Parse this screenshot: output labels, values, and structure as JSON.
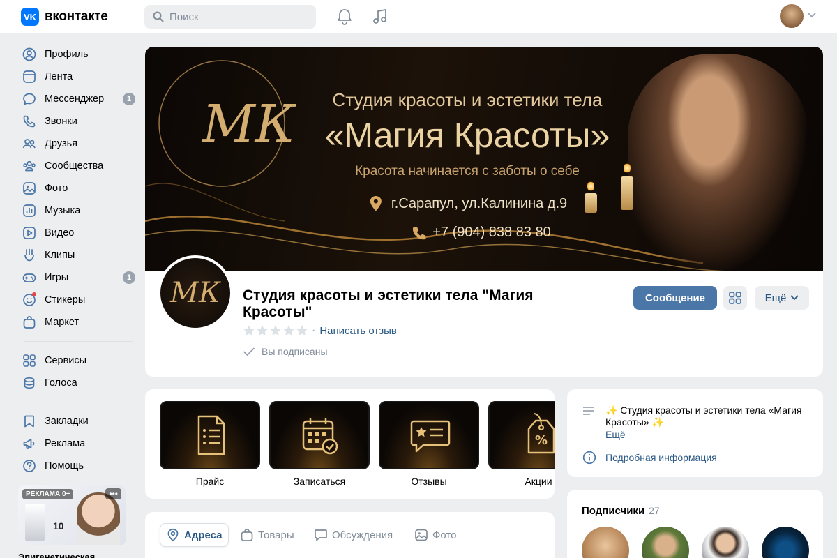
{
  "app": {
    "logo_mark": "VK",
    "logo_text": "вконтакте"
  },
  "search": {
    "placeholder": "Поиск"
  },
  "header": {
    "icons": [
      "bell-icon",
      "music-icon"
    ],
    "avatar": "user-avatar",
    "dropdown": "chevron-down-icon"
  },
  "sidebar": {
    "items": [
      {
        "label": "Профиль",
        "icon": "user-circle-icon"
      },
      {
        "label": "Лента",
        "icon": "feed-icon"
      },
      {
        "label": "Мессенджер",
        "icon": "message-icon",
        "badge": "1"
      },
      {
        "label": "Звонки",
        "icon": "phone-icon"
      },
      {
        "label": "Друзья",
        "icon": "friends-icon"
      },
      {
        "label": "Сообщества",
        "icon": "communities-icon"
      },
      {
        "label": "Фото",
        "icon": "photo-icon"
      },
      {
        "label": "Музыка",
        "icon": "music-icon"
      },
      {
        "label": "Видео",
        "icon": "video-icon"
      },
      {
        "label": "Клипы",
        "icon": "clips-icon"
      },
      {
        "label": "Игры",
        "icon": "gamepad-icon",
        "badge": "1"
      },
      {
        "label": "Стикеры",
        "icon": "sticker-icon"
      },
      {
        "label": "Маркет",
        "icon": "shopping-bag-icon"
      }
    ],
    "items2": [
      {
        "label": "Сервисы",
        "icon": "services-icon"
      },
      {
        "label": "Голоса",
        "icon": "coins-icon"
      }
    ],
    "items3": [
      {
        "label": "Закладки",
        "icon": "bookmark-icon"
      },
      {
        "label": "Реклама",
        "icon": "megaphone-icon"
      },
      {
        "label": "Помощь",
        "icon": "help-icon"
      }
    ]
  },
  "ad": {
    "label": "РЕКЛАМА 0+",
    "more": "•••",
    "number": "10",
    "caption": "Эпигенетическая"
  },
  "cover": {
    "title_line1": "Студия красоты и эстетики тела",
    "title_line2": "«Магия Красоты»",
    "tagline": "Красота начинается с заботы о себе",
    "address": "г.Сарапул, ул.Калинина д.9",
    "phone": "+7 (904) 838 83 80"
  },
  "group": {
    "name": "Студия красоты и эстетики тела \"Магия Красоты\"",
    "rating_stars": 0,
    "review_link": "Написать отзыв",
    "subscribed_text": "Вы подписаны",
    "message_button": "Сообщение",
    "more_button": "Ещё"
  },
  "tiles": [
    {
      "label": "Прайс",
      "icon": "price-list-icon"
    },
    {
      "label": "Записаться",
      "icon": "calendar-icon"
    },
    {
      "label": "Отзывы",
      "icon": "review-icon"
    },
    {
      "label": "Акции",
      "icon": "tag-icon"
    }
  ],
  "tabs": [
    {
      "label": "Адреса",
      "icon": "location-pin-icon",
      "active": true
    },
    {
      "label": "Товары",
      "icon": "bag-icon"
    },
    {
      "label": "Обсуждения",
      "icon": "chat-icon"
    },
    {
      "label": "Фото",
      "icon": "image-icon"
    }
  ],
  "about": {
    "description": "✨ Студия красоты и эстетики тела «Магия Красоты» ✨",
    "more_link": "Ещё",
    "info_link": "Подробная информация"
  },
  "subscribers": {
    "title": "Подписчики",
    "count": "27"
  },
  "colors": {
    "accent": "#4a76a8",
    "link": "#2a5885",
    "brand": "#0077ff",
    "bg": "#edeef0",
    "gold": "#e2c79a"
  }
}
